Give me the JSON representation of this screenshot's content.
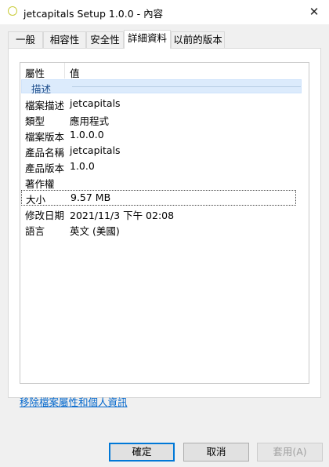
{
  "window": {
    "title": "jetcapitals Setup 1.0.0 - 內容",
    "close_glyph": "✕"
  },
  "tabs": [
    "一般",
    "相容性",
    "安全性",
    "詳細資料",
    "以前的版本"
  ],
  "active_tab": "詳細資料",
  "details": {
    "headers": {
      "property": "屬性",
      "value": "值"
    },
    "group": "描述",
    "rows": [
      {
        "key": "檔案描述",
        "value": "jetcapitals"
      },
      {
        "key": "類型",
        "value": "應用程式"
      },
      {
        "key": "檔案版本",
        "value": "1.0.0.0"
      },
      {
        "key": "產品名稱",
        "value": "jetcapitals"
      },
      {
        "key": "產品版本",
        "value": "1.0.0"
      },
      {
        "key": "著作權",
        "value": ""
      },
      {
        "key": "大小",
        "value": "9.57 MB"
      },
      {
        "key": "修改日期",
        "value": "2021/11/3 下午 02:08"
      },
      {
        "key": "語言",
        "value": "英文 (美國)"
      }
    ],
    "selected_row": "大小"
  },
  "remove_link": "移除檔案屬性和個人資訊",
  "buttons": {
    "ok": "確定",
    "cancel": "取消",
    "apply": "套用(A)"
  },
  "colors": {
    "accent": "#0078d7",
    "link": "#0066cc",
    "group_bg": "#dcebfc"
  }
}
